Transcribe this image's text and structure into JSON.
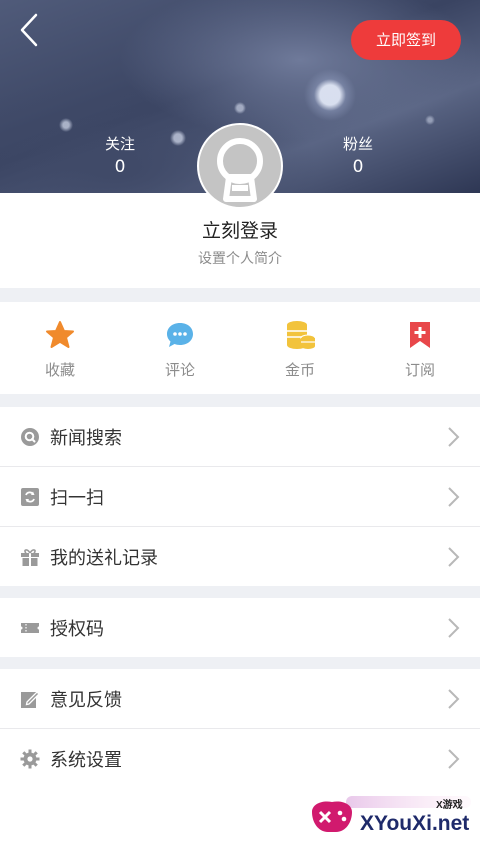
{
  "header": {
    "signin_label": "立即签到",
    "follow_label": "关注",
    "follow_count": "0",
    "fans_label": "粉丝",
    "fans_count": "0"
  },
  "profile": {
    "login_text": "立刻登录",
    "bio_placeholder": "设置个人简介"
  },
  "quick_actions": [
    {
      "label": "收藏",
      "icon": "star-icon",
      "color": "#f08a2c"
    },
    {
      "label": "评论",
      "icon": "comment-icon",
      "color": "#5ab2e8"
    },
    {
      "label": "金币",
      "icon": "coins-icon",
      "color": "#f2c33c"
    },
    {
      "label": "订阅",
      "icon": "bookmark-plus-icon",
      "color": "#e8474a"
    }
  ],
  "menu": {
    "news_search": "新闻搜索",
    "scan": "扫一扫",
    "gift_records": "我的送礼记录",
    "auth_code": "授权码",
    "feedback": "意见反馈",
    "settings": "系统设置"
  },
  "watermark": {
    "text": "XYouXi.net",
    "small": "X游戏"
  },
  "colors": {
    "accent": "#ee3b3b",
    "separator": "#eef0f4"
  }
}
